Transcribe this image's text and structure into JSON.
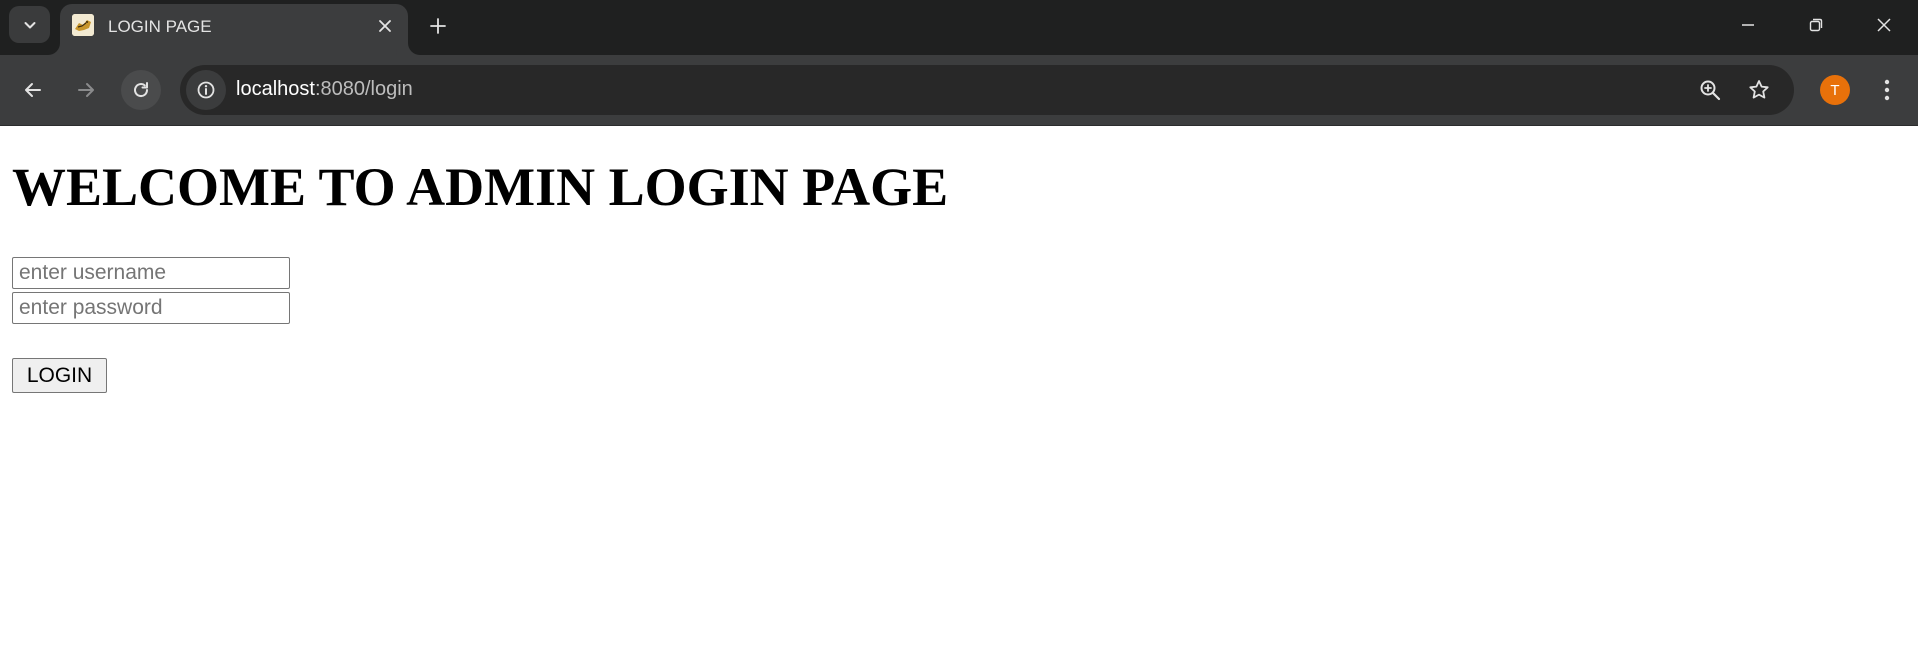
{
  "browser": {
    "tab": {
      "title": "LOGIN PAGE",
      "favicon": "tomcat-icon"
    },
    "address_bar": {
      "host": "localhost",
      "rest": ":8080/login"
    },
    "profile_initial": "T",
    "profile_color": "#e8710a",
    "icons": {
      "tab_search": "chevron-down-icon",
      "tab_close": "close-icon",
      "new_tab": "plus-icon",
      "minimize": "minimize-icon",
      "restore": "restore-icon",
      "close_window": "close-icon",
      "back": "arrow-left-icon",
      "forward": "arrow-right-icon",
      "reload": "reload-icon",
      "site_info": "info-icon",
      "zoom": "zoom-icon",
      "bookmark": "star-icon",
      "menu": "more-vert-icon"
    }
  },
  "page": {
    "heading": "WELCOME TO ADMIN LOGIN PAGE",
    "username": {
      "placeholder": "enter username",
      "value": ""
    },
    "password": {
      "placeholder": "enter password",
      "value": ""
    },
    "login_button": "LOGIN"
  }
}
